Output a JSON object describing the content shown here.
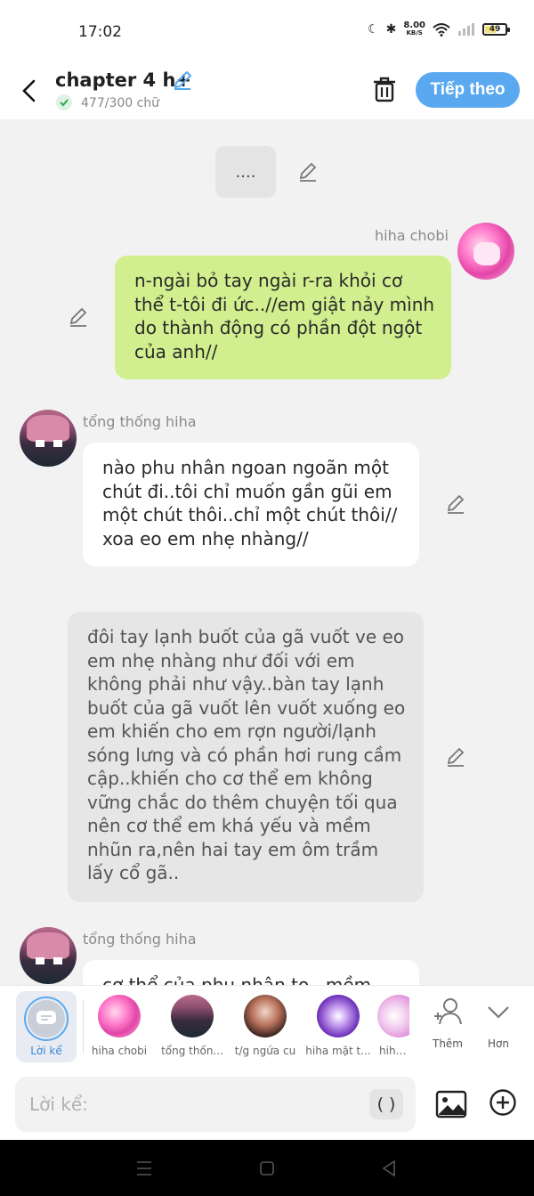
{
  "status": {
    "time": "17:02",
    "speed_value": "8.00",
    "speed_unit": "KB/S",
    "battery": "49"
  },
  "header": {
    "title": "chapter 4 h+",
    "word_count": "477/300 chữ",
    "next_label": "Tiếp theo"
  },
  "feed": {
    "note": "....",
    "messages": [
      {
        "sender": "hiha chobi",
        "text": "n-ngài bỏ tay ngài r-ra khỏi cơ thể t-tôi đi ức..//em giật nảy mình do thành động có phần đột ngột của anh//"
      },
      {
        "sender": "tổng thống hiha",
        "text": "nào phu nhân ngoan ngoãn một chút đi..tôi chỉ muốn gần gũi em một chút thôi..chỉ một chút thôi// xoa eo em nhẹ nhàng//"
      },
      {
        "sender": "",
        "text": "đôi tay lạnh buốt của gã vuốt ve eo em nhẹ nhàng như đối với em không phải như vậy..bàn tay lạnh buốt của gã vuốt lên vuốt xuống eo em khiến cho em rợn người/lạnh sóng lưng và có phần hơi rung cầm cập..khiến cho cơ thể em không vững chắc do thêm chuyện tối qua nên cơ thể em khá yếu và mềm nhũn ra,nên hai tay em ôm trầm lấy cổ gã.."
      },
      {
        "sender": "tổng thống hiha",
        "text": "cơ thể của phu nhân to...mềm"
      }
    ]
  },
  "characters": {
    "narrator": "Lời kể",
    "items": [
      "hiha chobi",
      "tổng thốn...",
      "t/g ngứa cu",
      "hiha mặt t...",
      "hiha k"
    ],
    "add_label": "Thêm",
    "more_label": "Hơn"
  },
  "input": {
    "placeholder": "Lời kể:",
    "paren_label": "( )"
  },
  "colors": {
    "accent": "#5aa9f0",
    "green_bubble": "#d1ef8e",
    "grey_bubble": "#e6e6e6"
  }
}
